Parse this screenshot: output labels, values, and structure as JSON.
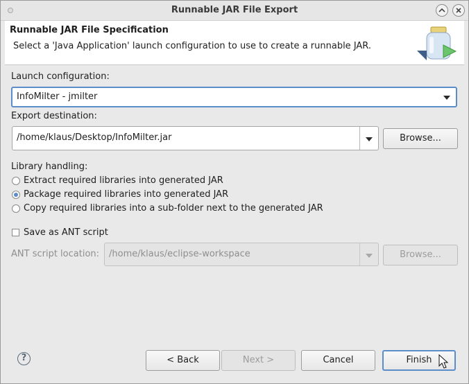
{
  "window": {
    "title": "Runnable JAR File Export"
  },
  "header": {
    "title": "Runnable JAR File Specification",
    "description": "Select a 'Java Application' launch configuration to use to create a runnable JAR."
  },
  "launch": {
    "label": "Launch configuration:",
    "value": "InfoMilter - jmilter"
  },
  "export": {
    "label": "Export destination:",
    "value": "/home/klaus/Desktop/InfoMilter.jar",
    "browse": "Browse..."
  },
  "library": {
    "label": "Library handling:",
    "options": [
      {
        "label": "Extract required libraries into generated JAR",
        "checked": false
      },
      {
        "label": "Package required libraries into generated JAR",
        "checked": true
      },
      {
        "label": "Copy required libraries into a sub-folder next to the generated JAR",
        "checked": false
      }
    ]
  },
  "ant": {
    "save_label": "Save as ANT script",
    "location_label": "ANT script location:",
    "location_value": "/home/klaus/eclipse-workspace",
    "browse": "Browse..."
  },
  "buttons": {
    "back": "< Back",
    "next": "Next >",
    "cancel": "Cancel",
    "finish": "Finish",
    "help": "?"
  },
  "colors": {
    "accent": "#5b8ec9",
    "window_bg": "#e9e9e9"
  }
}
